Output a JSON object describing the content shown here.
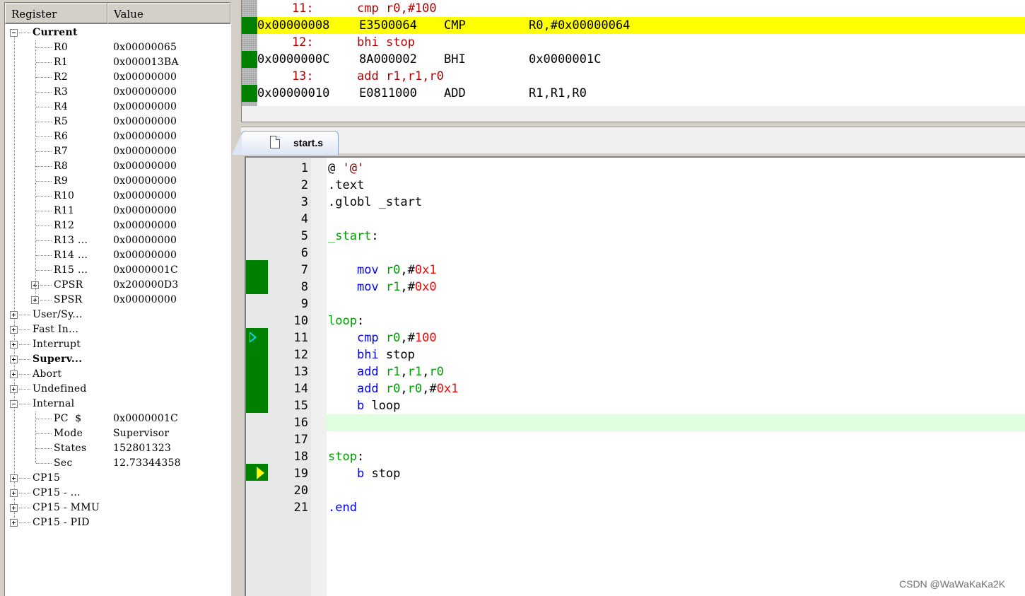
{
  "registers": {
    "header": {
      "register": "Register",
      "value": "Value"
    },
    "current_label": "Current",
    "current": [
      {
        "name": "R0",
        "value": "0x00000065"
      },
      {
        "name": "R1",
        "value": "0x000013BA"
      },
      {
        "name": "R2",
        "value": "0x00000000"
      },
      {
        "name": "R3",
        "value": "0x00000000"
      },
      {
        "name": "R4",
        "value": "0x00000000"
      },
      {
        "name": "R5",
        "value": "0x00000000"
      },
      {
        "name": "R6",
        "value": "0x00000000"
      },
      {
        "name": "R7",
        "value": "0x00000000"
      },
      {
        "name": "R8",
        "value": "0x00000000"
      },
      {
        "name": "R9",
        "value": "0x00000000"
      },
      {
        "name": "R10",
        "value": "0x00000000"
      },
      {
        "name": "R11",
        "value": "0x00000000"
      },
      {
        "name": "R12",
        "value": "0x00000000"
      },
      {
        "name": "R13 ...",
        "value": "0x00000000"
      },
      {
        "name": "R14 ...",
        "value": "0x00000000"
      },
      {
        "name": "R15 ...",
        "value": "0x0000001C"
      },
      {
        "name": "CPSR",
        "value": "0x200000D3"
      },
      {
        "name": "SPSR",
        "value": "0x00000000"
      }
    ],
    "modes": [
      "User/Sy...",
      "Fast In...",
      "Interrupt",
      "Superv...",
      "Abort",
      "Undefined"
    ],
    "internal_label": "Internal",
    "internal": [
      {
        "name": "PC  $",
        "value": "0x0000001C"
      },
      {
        "name": "Mode",
        "value": "Supervisor"
      },
      {
        "name": "States",
        "value": "152801323"
      },
      {
        "name": "Sec",
        "value": "12.73344358"
      }
    ],
    "cp15": [
      "CP15",
      "CP15 - ...",
      "CP15 - MMU",
      "CP15 - PID"
    ]
  },
  "disassembly": {
    "rows": [
      {
        "kind": "src",
        "text": "    11:      cmp r0,#100"
      },
      {
        "kind": "asm",
        "addr": "0x00000008",
        "opcode": "E3500064",
        "mnemonic": "CMP",
        "operands": "R0,#0x00000064",
        "highlight": true
      },
      {
        "kind": "src",
        "text": "    12:      bhi stop"
      },
      {
        "kind": "asm",
        "addr": "0x0000000C",
        "opcode": "8A000002",
        "mnemonic": "BHI",
        "operands": "0x0000001C",
        "highlight": false
      },
      {
        "kind": "src",
        "text": "    13:      add r1,r1,r0"
      },
      {
        "kind": "asm",
        "addr": "0x00000010",
        "opcode": "E0811000",
        "mnemonic": "ADD",
        "operands": "R1,R1,R0",
        "highlight": false
      }
    ]
  },
  "editor": {
    "tab_label": "start.s",
    "line_numbers": [
      "1",
      "2",
      "3",
      "4",
      "5",
      "6",
      "7",
      "8",
      "9",
      "10",
      "11",
      "12",
      "13",
      "14",
      "15",
      "16",
      "17",
      "18",
      "19",
      "20",
      "21"
    ],
    "lines": [
      [
        {
          "t": "@ ",
          "c": "black"
        },
        {
          "t": "'@'",
          "c": "brown"
        }
      ],
      [
        {
          "t": ".text",
          "c": "black"
        }
      ],
      [
        {
          "t": ".globl _start",
          "c": "black"
        }
      ],
      [],
      [
        {
          "t": "_start",
          "c": "green"
        },
        {
          "t": ":",
          "c": "black"
        }
      ],
      [],
      [
        {
          "t": "    ",
          "c": "black"
        },
        {
          "t": "mov",
          "c": "blue"
        },
        {
          "t": " ",
          "c": "black"
        },
        {
          "t": "r0",
          "c": "green"
        },
        {
          "t": ",#",
          "c": "black"
        },
        {
          "t": "0x1",
          "c": "red"
        }
      ],
      [
        {
          "t": "    ",
          "c": "black"
        },
        {
          "t": "mov",
          "c": "blue"
        },
        {
          "t": " ",
          "c": "black"
        },
        {
          "t": "r1",
          "c": "green"
        },
        {
          "t": ",#",
          "c": "black"
        },
        {
          "t": "0x0",
          "c": "red"
        }
      ],
      [],
      [
        {
          "t": "loop",
          "c": "green"
        },
        {
          "t": ":",
          "c": "black"
        }
      ],
      [
        {
          "t": "    ",
          "c": "black"
        },
        {
          "t": "cmp",
          "c": "blue"
        },
        {
          "t": " ",
          "c": "black"
        },
        {
          "t": "r0",
          "c": "green"
        },
        {
          "t": ",#",
          "c": "black"
        },
        {
          "t": "100",
          "c": "red"
        }
      ],
      [
        {
          "t": "    ",
          "c": "black"
        },
        {
          "t": "bhi",
          "c": "blue"
        },
        {
          "t": " stop",
          "c": "black"
        }
      ],
      [
        {
          "t": "    ",
          "c": "black"
        },
        {
          "t": "add",
          "c": "blue"
        },
        {
          "t": " ",
          "c": "black"
        },
        {
          "t": "r1",
          "c": "green"
        },
        {
          "t": ",",
          "c": "black"
        },
        {
          "t": "r1",
          "c": "green"
        },
        {
          "t": ",",
          "c": "black"
        },
        {
          "t": "r0",
          "c": "green"
        }
      ],
      [
        {
          "t": "    ",
          "c": "black"
        },
        {
          "t": "add",
          "c": "blue"
        },
        {
          "t": " ",
          "c": "black"
        },
        {
          "t": "r0",
          "c": "green"
        },
        {
          "t": ",",
          "c": "black"
        },
        {
          "t": "r0",
          "c": "green"
        },
        {
          "t": ",#",
          "c": "black"
        },
        {
          "t": "0x1",
          "c": "red"
        }
      ],
      [
        {
          "t": "    ",
          "c": "black"
        },
        {
          "t": "b",
          "c": "blue"
        },
        {
          "t": " loop",
          "c": "black"
        }
      ],
      [],
      [],
      [
        {
          "t": "stop",
          "c": "green"
        },
        {
          "t": ":",
          "c": "black"
        }
      ],
      [
        {
          "t": "    ",
          "c": "black"
        },
        {
          "t": "b",
          "c": "blue"
        },
        {
          "t": " stop",
          "c": "black"
        }
      ],
      [],
      [
        {
          "t": ".end",
          "c": "blue"
        }
      ]
    ],
    "current_line": "16",
    "pc_line": "11",
    "next_line": "19"
  },
  "watermark": "CSDN @WaWaKaKa2K",
  "colors": {
    "highlight": "#ffff00",
    "executed": "#008000",
    "current_line": "#e0ffe0"
  }
}
